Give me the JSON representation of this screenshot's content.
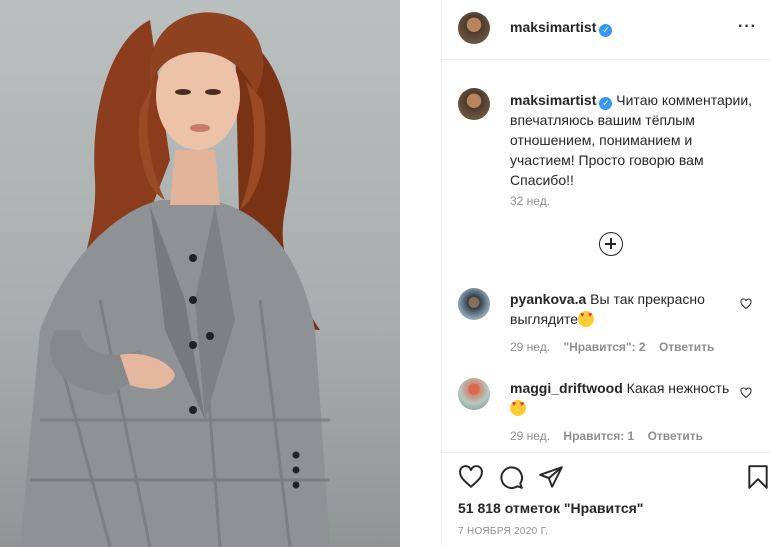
{
  "post": {
    "author": "maksimartist",
    "verified": true,
    "more_icon": "more-horizontal-icon",
    "caption_text": "Читаю комментарии, впечатляюсь вашим тёплым отношением, пониманием и участием! Просто говорю вам Спасибо!!",
    "caption_time": "32 нед.",
    "load_more_icon": "plus-circle-icon"
  },
  "comments": [
    {
      "username": "pyankova.a",
      "text": "Вы так прекрасно выглядите",
      "emoji": "heart-eyes-emoji",
      "time": "29 нед.",
      "likes": "\"Нравится\": 2",
      "reply": "Ответить"
    },
    {
      "username": "maggi_driftwood",
      "text": "Какая нежность",
      "emoji": "heart-eyes-emoji",
      "time": "29 нед.",
      "likes": "Нравится: 1",
      "reply": "Ответить"
    }
  ],
  "actions": {
    "like_icon": "heart-icon",
    "comment_icon": "comment-icon",
    "share_icon": "send-icon",
    "save_icon": "bookmark-icon"
  },
  "likes_text": "51 818 отметок \"Нравится\"",
  "date_text": "7 НОЯБРЯ 2020 Г.",
  "colors": {
    "text": "#262626",
    "muted": "#8e8e8e",
    "verified": "#3897f0",
    "divider": "#efefef"
  }
}
